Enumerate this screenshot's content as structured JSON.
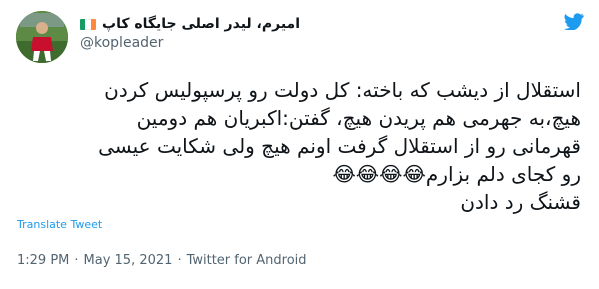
{
  "author": {
    "display_name": "امیرم، لیدر اصلی جایگاه کاپ",
    "handle": "@kopleader",
    "flag_colors": [
      "#169b62",
      "#ffffff",
      "#ff883e"
    ]
  },
  "icons": {
    "brand": "twitter-bird-icon",
    "brand_color": "#1d9bf0"
  },
  "tweet": {
    "lines": [
      "استقلال از دیشب که باخته: کل دولت رو پرسپولیس کردن",
      "هیچ،به جهرمی هم پریدن هیچ، گفتن:اکبریان هم دومین",
      "قهرمانی رو از استقلال گرفت اونم هیچ ولی شکایت عیسی",
      "رو کجای دلم بزارم😂😂😂😂",
      "قشنگ رد دادن"
    ]
  },
  "translate_label": "Translate Tweet",
  "meta": {
    "time": "1:29 PM",
    "separator": "·",
    "date": "May 15, 2021",
    "source": "Twitter for Android"
  }
}
